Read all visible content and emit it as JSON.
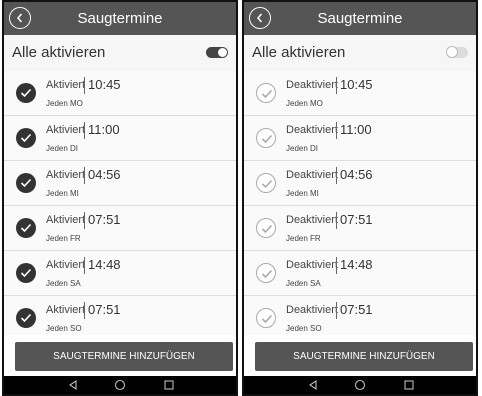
{
  "screens": [
    {
      "header": {
        "title": "Saugtermine"
      },
      "toggle_all": {
        "label": "Alle aktivieren",
        "state": "on"
      },
      "items": [
        {
          "status": "Aktiviert",
          "time": "10:45",
          "day": "Jeden MO",
          "checked": true
        },
        {
          "status": "Aktiviert",
          "time": "11:00",
          "day": "Jeden DI",
          "checked": true
        },
        {
          "status": "Aktiviert",
          "time": "04:56",
          "day": "Jeden MI",
          "checked": true
        },
        {
          "status": "Aktiviert",
          "time": "07:51",
          "day": "Jeden FR",
          "checked": true
        },
        {
          "status": "Aktiviert",
          "time": "14:48",
          "day": "Jeden SA",
          "checked": true
        },
        {
          "status": "Aktiviert",
          "time": "07:51",
          "day": "Jeden SO",
          "checked": true
        }
      ],
      "add_button": "SAUGTERMINE HINZUFÜGEN"
    },
    {
      "header": {
        "title": "Saugtermine"
      },
      "toggle_all": {
        "label": "Alle aktivieren",
        "state": "off"
      },
      "items": [
        {
          "status": "Deaktiviert",
          "time": "10:45",
          "day": "Jeden MO",
          "checked": false
        },
        {
          "status": "Deaktiviert",
          "time": "11:00",
          "day": "Jeden DI",
          "checked": false
        },
        {
          "status": "Deaktiviert",
          "time": "04:56",
          "day": "Jeden MI",
          "checked": false
        },
        {
          "status": "Deaktiviert",
          "time": "07:51",
          "day": "Jeden FR",
          "checked": false
        },
        {
          "status": "Deaktiviert",
          "time": "14:48",
          "day": "Jeden SA",
          "checked": false
        },
        {
          "status": "Deaktiviert",
          "time": "07:51",
          "day": "Jeden SO",
          "checked": false
        }
      ],
      "add_button": "SAUGTERMINE HINZUFÜGEN"
    }
  ],
  "navbar": {
    "icons": [
      "back-triangle-icon",
      "home-circle-icon",
      "recents-square-icon"
    ]
  },
  "colors": {
    "header": "#555555",
    "check_on": "#333333",
    "check_off_border": "#aaaaaa",
    "button": "#555555"
  }
}
